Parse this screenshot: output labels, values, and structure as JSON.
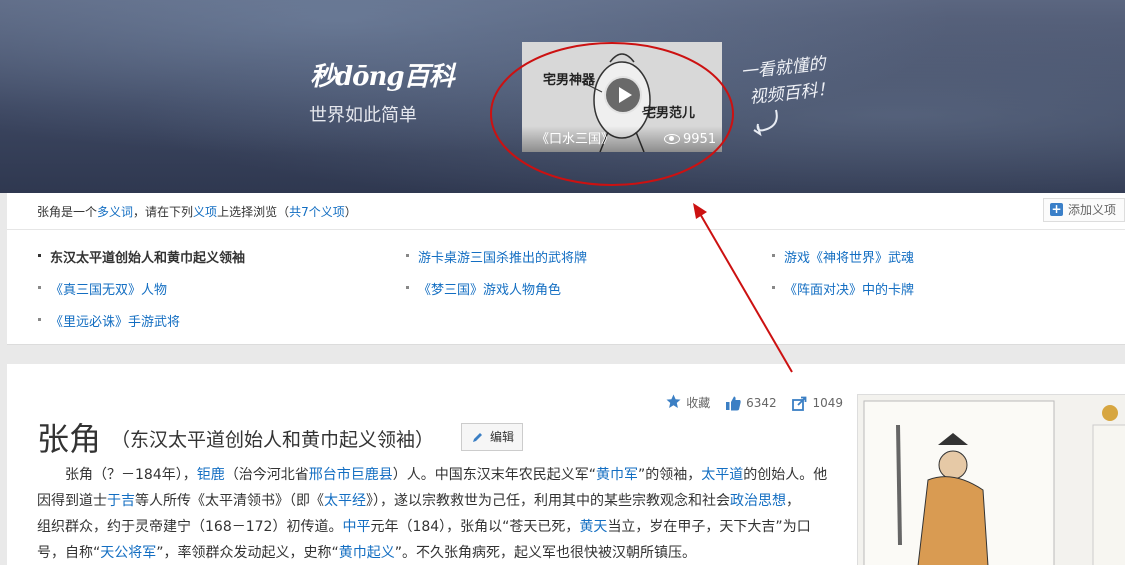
{
  "banner": {
    "logo": "秒dōng百科",
    "slogan": "世界如此简单",
    "video": {
      "label_left": "宅男神器",
      "label_right": "宅男范儿",
      "title": "《口水三国》",
      "views": "9951"
    },
    "handwriting": [
      "一看就懂的",
      "视频百科！"
    ]
  },
  "disambig": {
    "notice_prefix": "张角是一个",
    "notice_term": "多义词",
    "notice_mid": "，请在下列",
    "notice_yixiang": "义项",
    "notice_suffix": "上选择浏览（",
    "notice_count": "共7个义项",
    "notice_end": "）",
    "add_label": "添加义项",
    "senses": [
      "东汉太平道创始人和黄巾起义领袖",
      "游卡桌游三国杀推出的武将牌",
      "游戏《神将世界》武魂",
      "《真三国无双》人物",
      "《梦三国》游戏人物角色",
      "《阵面对决》中的卡牌",
      "《里远必诛》手游武将"
    ]
  },
  "article": {
    "actions": {
      "collect": "收藏",
      "likes": "6342",
      "shares": "1049"
    },
    "title": "张角",
    "subtitle": "（东汉太平道创始人和黄巾起义领袖）",
    "edit_label": "编辑",
    "lines": [
      [
        "张角（？－184年），",
        "钜鹿",
        "（治今河北省",
        "邢台市巨鹿县",
        "）人。中国东汉末年农民起义军“",
        "黄巾军",
        "”的领袖，",
        "太平道",
        "的创始人。他"
      ],
      [
        "因得到道士",
        "于吉",
        "等人所传《太平清领书》（即《",
        "太平经",
        "》），遂以宗教救世为己任，利用其中的某些宗教观念和社会",
        "政治思想",
        "，"
      ],
      [
        "组织群众，约于灵帝建宁（168－172）初传道。",
        "中平",
        "元年（184），张角以“苍天已死，",
        "黄天",
        "当立，岁在甲子，天下大吉”为口"
      ],
      [
        "号，自称“",
        "天公将军",
        "”，率领群众发动起义，史称“",
        "黄巾起义",
        "”。不久张角病死，起义军也很快被汉朝所镇压。"
      ]
    ]
  },
  "colors": {
    "link": "#136ec2",
    "annotation": "#cc1111"
  }
}
